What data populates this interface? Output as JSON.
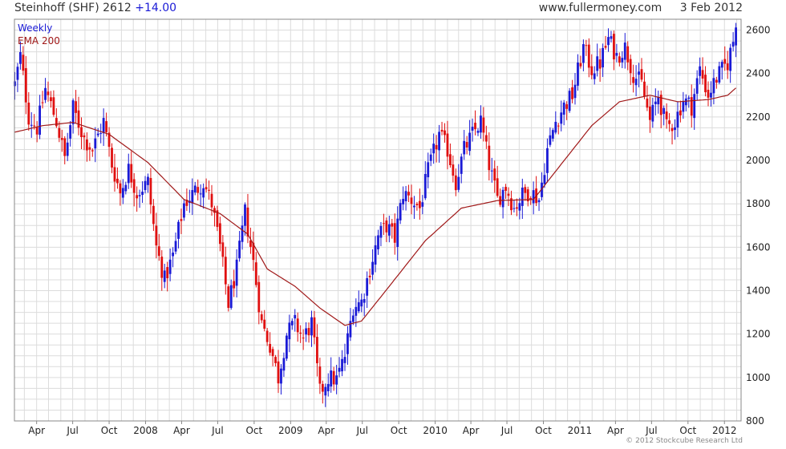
{
  "header": {
    "title": "Steinhoff (SHF) 2612",
    "change": "+14.00",
    "site": "www.fullermoney.com",
    "date": "3 Feb 2012"
  },
  "footer": {
    "copyright": "© 2012 Stockcube Research Ltd"
  },
  "colors": {
    "up": "#1a1ad6",
    "down": "#e01010",
    "ema": "#a01818",
    "grid": "#dcdcdc",
    "frame": "#888888"
  },
  "chart_data": {
    "type": "candlestick",
    "interval_label": "Weekly",
    "legend": [
      {
        "name": "Weekly",
        "color": "#1a1ad6"
      },
      {
        "name": "EMA 200",
        "color": "#a01818"
      }
    ],
    "legend_position": "top-left",
    "y_axis_side": "right",
    "ylim": [
      800,
      2650
    ],
    "y_ticks": [
      800,
      1000,
      1200,
      1400,
      1600,
      1800,
      2000,
      2200,
      2400,
      2600
    ],
    "x_tick_labels": [
      "Apr",
      "Jul",
      "Oct",
      "2008",
      "Apr",
      "Jul",
      "Oct",
      "2009",
      "Apr",
      "Jul",
      "Oct",
      "2010",
      "Apr",
      "Jul",
      "Oct",
      "2011",
      "Apr",
      "Jul",
      "Oct",
      "2012"
    ],
    "grid": true,
    "close_anchors": [
      [
        "2007-02-05",
        2350
      ],
      [
        "2007-02-19",
        2480
      ],
      [
        "2007-03-12",
        2200
      ],
      [
        "2007-04-02",
        2150
      ],
      [
        "2007-04-23",
        2330
      ],
      [
        "2007-05-21",
        2180
      ],
      [
        "2007-06-11",
        2010
      ],
      [
        "2007-07-02",
        2240
      ],
      [
        "2007-07-30",
        2100
      ],
      [
        "2007-08-20",
        2050
      ],
      [
        "2007-09-17",
        2180
      ],
      [
        "2007-10-08",
        1980
      ],
      [
        "2007-10-29",
        1850
      ],
      [
        "2007-11-19",
        1960
      ],
      [
        "2007-12-10",
        1850
      ],
      [
        "2008-01-07",
        1900
      ],
      [
        "2008-01-28",
        1600
      ],
      [
        "2008-02-18",
        1450
      ],
      [
        "2008-03-10",
        1560
      ],
      [
        "2008-04-07",
        1800
      ],
      [
        "2008-05-05",
        1860
      ],
      [
        "2008-05-26",
        1900
      ],
      [
        "2008-06-16",
        1800
      ],
      [
        "2008-07-07",
        1600
      ],
      [
        "2008-07-28",
        1340
      ],
      [
        "2008-08-18",
        1500
      ],
      [
        "2008-09-08",
        1760
      ],
      [
        "2008-09-29",
        1530
      ],
      [
        "2008-10-20",
        1250
      ],
      [
        "2008-11-10",
        1150
      ],
      [
        "2008-12-01",
        1000
      ],
      [
        "2008-12-22",
        1200
      ],
      [
        "2009-01-12",
        1250
      ],
      [
        "2009-02-02",
        1180
      ],
      [
        "2009-02-23",
        1250
      ],
      [
        "2009-03-16",
        930
      ],
      [
        "2009-04-06",
        1000
      ],
      [
        "2009-04-27",
        990
      ],
      [
        "2009-05-18",
        1100
      ],
      [
        "2009-06-08",
        1330
      ],
      [
        "2009-06-29",
        1350
      ],
      [
        "2009-07-20",
        1500
      ],
      [
        "2009-08-10",
        1650
      ],
      [
        "2009-08-31",
        1700
      ],
      [
        "2009-09-21",
        1640
      ],
      [
        "2009-10-12",
        1850
      ],
      [
        "2009-11-02",
        1820
      ],
      [
        "2009-11-23",
        1780
      ],
      [
        "2009-12-14",
        1950
      ],
      [
        "2010-01-11",
        2120
      ],
      [
        "2010-02-01",
        2050
      ],
      [
        "2010-02-22",
        1900
      ],
      [
        "2010-03-15",
        2050
      ],
      [
        "2010-04-05",
        2120
      ],
      [
        "2010-04-26",
        2180
      ],
      [
        "2010-05-17",
        1980
      ],
      [
        "2010-06-07",
        1820
      ],
      [
        "2010-06-28",
        1880
      ],
      [
        "2010-07-19",
        1780
      ],
      [
        "2010-08-09",
        1840
      ],
      [
        "2010-08-30",
        1860
      ],
      [
        "2010-09-20",
        1820
      ],
      [
        "2010-10-11",
        2050
      ],
      [
        "2010-11-01",
        2180
      ],
      [
        "2010-11-22",
        2250
      ],
      [
        "2010-12-13",
        2300
      ],
      [
        "2011-01-10",
        2520
      ],
      [
        "2011-01-31",
        2420
      ],
      [
        "2011-02-21",
        2450
      ],
      [
        "2011-03-14",
        2560
      ],
      [
        "2011-04-04",
        2480
      ],
      [
        "2011-04-25",
        2520
      ],
      [
        "2011-05-16",
        2400
      ],
      [
        "2011-06-06",
        2350
      ],
      [
        "2011-06-27",
        2180
      ],
      [
        "2011-07-18",
        2300
      ],
      [
        "2011-08-08",
        2150
      ],
      [
        "2011-08-29",
        2180
      ],
      [
        "2011-09-19",
        2280
      ],
      [
        "2011-10-10",
        2250
      ],
      [
        "2011-10-31",
        2420
      ],
      [
        "2011-11-21",
        2300
      ],
      [
        "2011-12-12",
        2380
      ],
      [
        "2012-01-09",
        2450
      ],
      [
        "2012-01-23",
        2550
      ],
      [
        "2012-02-03",
        2612
      ]
    ],
    "ema200_anchors": [
      [
        "2007-02-05",
        2130
      ],
      [
        "2007-04-16",
        2160
      ],
      [
        "2007-07-02",
        2175
      ],
      [
        "2007-10-01",
        2120
      ],
      [
        "2008-01-07",
        1990
      ],
      [
        "2008-04-07",
        1820
      ],
      [
        "2008-07-07",
        1755
      ],
      [
        "2008-09-15",
        1660
      ],
      [
        "2008-11-03",
        1500
      ],
      [
        "2009-01-12",
        1420
      ],
      [
        "2009-03-16",
        1320
      ],
      [
        "2009-05-18",
        1240
      ],
      [
        "2009-06-29",
        1260
      ],
      [
        "2009-09-07",
        1420
      ],
      [
        "2009-12-07",
        1630
      ],
      [
        "2010-03-08",
        1780
      ],
      [
        "2010-06-07",
        1815
      ],
      [
        "2010-09-06",
        1820
      ],
      [
        "2010-11-01",
        1950
      ],
      [
        "2011-01-31",
        2160
      ],
      [
        "2011-04-11",
        2270
      ],
      [
        "2011-06-27",
        2300
      ],
      [
        "2011-09-05",
        2270
      ],
      [
        "2011-11-21",
        2280
      ],
      [
        "2012-01-09",
        2300
      ],
      [
        "2012-02-03",
        2340
      ]
    ]
  }
}
